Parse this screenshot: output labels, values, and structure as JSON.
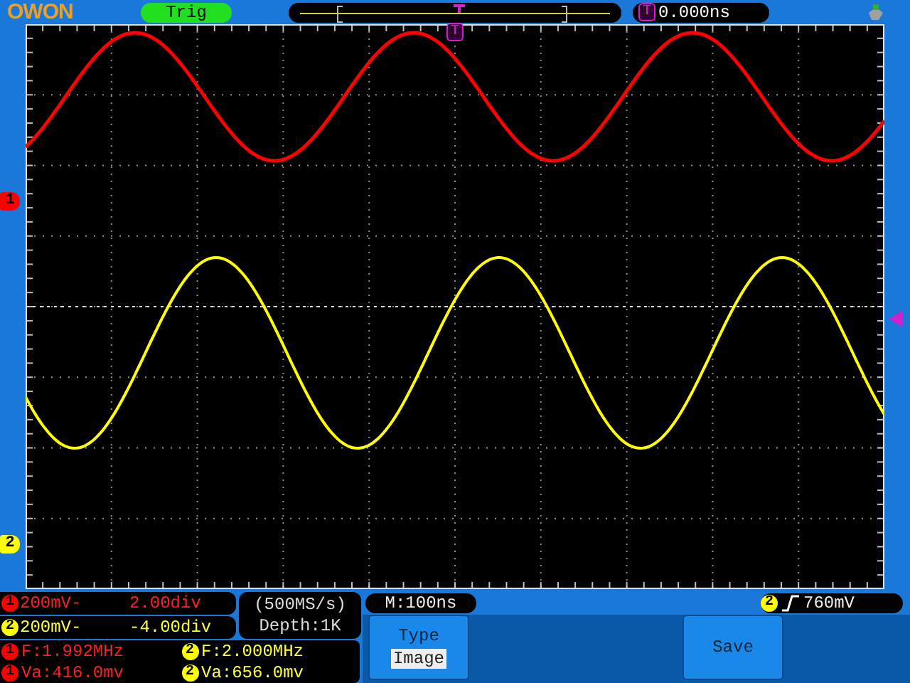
{
  "header": {
    "logo": "OWON",
    "trig_status": "Trig",
    "trigger_marker": "T",
    "time_offset": "0.000ns"
  },
  "plot": {
    "trigger_marker": "T",
    "channel_markers": [
      {
        "badge": "1",
        "color": "#ff0000"
      },
      {
        "badge": "2",
        "color": "#ffff00"
      }
    ]
  },
  "channel_settings": [
    {
      "badge": "1",
      "color": "#ff0000",
      "scale": "200mV-",
      "offset": "2.00div"
    },
    {
      "badge": "2",
      "color": "#ffff00",
      "scale": "200mV-",
      "offset": "-4.00div"
    }
  ],
  "acquisition": {
    "sample_rate": "(500MS/s)",
    "depth": "Depth:1K"
  },
  "measurements": [
    {
      "frequency_badge": "1",
      "amplitude_badge": "1",
      "color": "#ff0000",
      "frequency": "F:1.992MHz",
      "amplitude": "Va:416.0mv"
    },
    {
      "frequency_badge": "2",
      "amplitude_badge": "2",
      "color": "#ffff00",
      "frequency": "F:2.000MHz",
      "amplitude": "Va:656.0mv"
    }
  ],
  "timebase": "M:100ns",
  "trigger": {
    "badge": "2",
    "color": "#ffff00",
    "value": "760mV"
  },
  "menu": [
    {
      "kind": "option",
      "label": "Type",
      "value": "Image"
    },
    {
      "kind": "action",
      "label": "Save"
    }
  ]
}
